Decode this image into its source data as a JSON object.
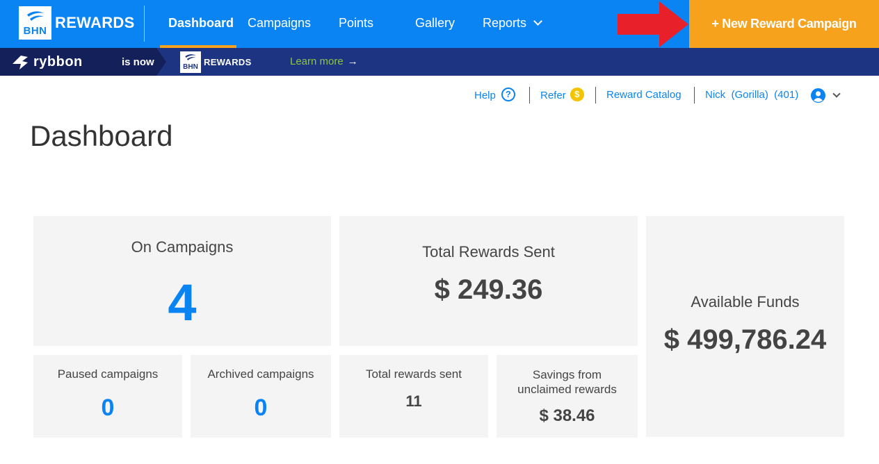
{
  "nav": {
    "brand_logo_text": "BHN",
    "brand_name": "REWARDS",
    "items": [
      {
        "label": "Dashboard",
        "active": true
      },
      {
        "label": "Campaigns"
      },
      {
        "label": "Points"
      },
      {
        "label": "Gallery"
      },
      {
        "label": "Reports",
        "has_dropdown": true
      }
    ],
    "cta_label": "+ New Reward Campaign"
  },
  "banner": {
    "old_brand": "rybbon",
    "is_now": "is now",
    "new_logo_text": "BHN",
    "new_brand": "REWARDS",
    "link_label": "Learn more"
  },
  "utility": {
    "help": "Help",
    "refer": "Refer",
    "catalog": "Reward Catalog",
    "user": "Nick  (Gorilla)  (401)"
  },
  "page": {
    "title": "Dashboard"
  },
  "cards": {
    "on_campaigns": {
      "label": "On Campaigns",
      "value": "4"
    },
    "total_rewards_sent": {
      "label": "Total Rewards Sent",
      "value": "$ 249.36"
    },
    "available_funds": {
      "label": "Available Funds",
      "value": "$ 499,786.24"
    },
    "paused": {
      "label": "Paused campaigns",
      "value": "0"
    },
    "archived": {
      "label": "Archived campaigns",
      "value": "0"
    },
    "total_count": {
      "label": "Total rewards sent",
      "value": "11"
    },
    "savings": {
      "label_line1": "Savings from",
      "label_line2": "unclaimed rewards",
      "value": "$ 38.46"
    }
  },
  "colors": {
    "primary": "#0b84f3",
    "accent": "#f6a21d",
    "banner": "#1d3482",
    "arrow": "#e8202a",
    "card_bg": "#f4f4f4"
  }
}
